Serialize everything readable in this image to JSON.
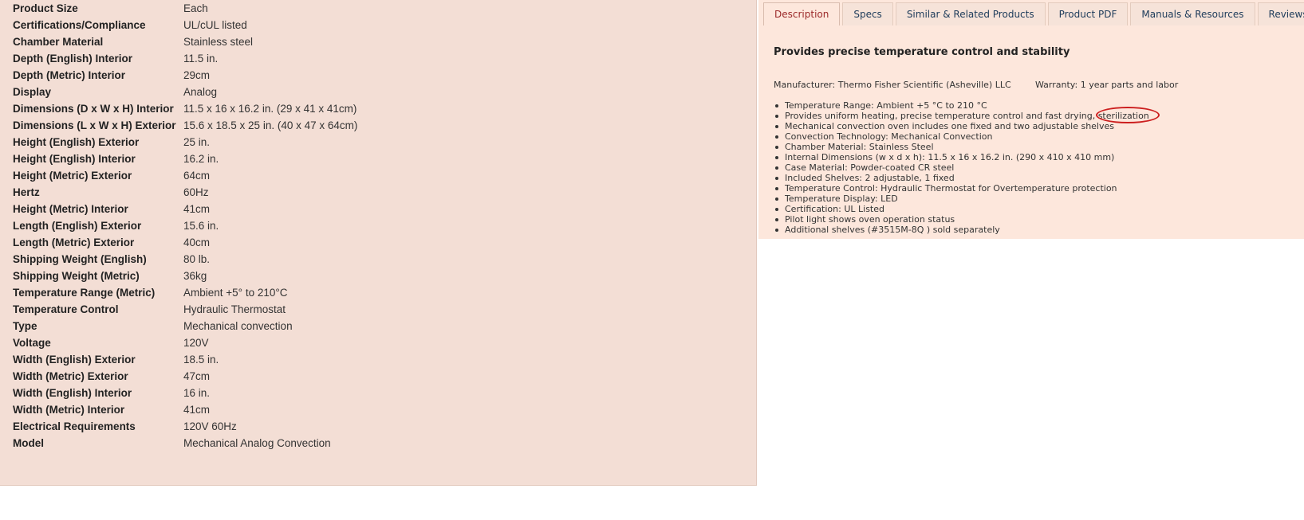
{
  "specs": [
    {
      "name": "Product Size",
      "value": "Each"
    },
    {
      "name": "Certifications/Compliance",
      "value": "UL/cUL listed"
    },
    {
      "name": "Chamber Material",
      "value": "Stainless steel"
    },
    {
      "name": "Depth (English) Interior",
      "value": "11.5 in."
    },
    {
      "name": "Depth (Metric) Interior",
      "value": "29cm"
    },
    {
      "name": "Display",
      "value": "Analog"
    },
    {
      "name": "Dimensions (D x W x H) Interior",
      "value": "11.5 x 16 x 16.2 in. (29 x 41 x 41cm)"
    },
    {
      "name": "Dimensions (L x W x H) Exterior",
      "value": "15.6 x 18.5 x 25 in. (40 x 47 x 64cm)"
    },
    {
      "name": "Height (English) Exterior",
      "value": "25 in."
    },
    {
      "name": "Height (English) Interior",
      "value": "16.2 in."
    },
    {
      "name": "Height (Metric) Exterior",
      "value": "64cm"
    },
    {
      "name": "Hertz",
      "value": "60Hz"
    },
    {
      "name": "Height (Metric) Interior",
      "value": "41cm"
    },
    {
      "name": "Length (English) Exterior",
      "value": "15.6 in."
    },
    {
      "name": "Length (Metric) Exterior",
      "value": "40cm"
    },
    {
      "name": "Shipping Weight (English)",
      "value": "80 lb."
    },
    {
      "name": "Shipping Weight (Metric)",
      "value": "36kg"
    },
    {
      "name": "Temperature Range (Metric)",
      "value": "Ambient +5° to 210°C"
    },
    {
      "name": "Temperature Control",
      "value": "Hydraulic Thermostat"
    },
    {
      "name": "Type",
      "value": "Mechanical convection"
    },
    {
      "name": "Voltage",
      "value": "120V"
    },
    {
      "name": "Width (English) Exterior",
      "value": "18.5 in."
    },
    {
      "name": "Width (Metric) Exterior",
      "value": "47cm"
    },
    {
      "name": "Width (English) Interior",
      "value": "16 in."
    },
    {
      "name": "Width (Metric) Interior",
      "value": "41cm"
    },
    {
      "name": "Electrical Requirements",
      "value": "120V 60Hz"
    },
    {
      "name": "Model",
      "value": "Mechanical Analog Convection"
    }
  ],
  "tabs": [
    {
      "label": "Description",
      "active": true
    },
    {
      "label": "Specs",
      "active": false
    },
    {
      "label": "Similar & Related Products",
      "active": false
    },
    {
      "label": "Product PDF",
      "active": false
    },
    {
      "label": "Manuals & Resources",
      "active": false
    },
    {
      "label": "Reviews",
      "active": false
    }
  ],
  "description": {
    "heading": "Provides precise temperature control and stability",
    "manufacturer": "Manufacturer: Thermo Fisher Scientific (Asheville) LLC",
    "warranty": "Warranty: 1 year parts and labor",
    "features": [
      "Temperature Range: Ambient +5 °C to 210 °C",
      "Provides uniform heating, precise temperature control and fast drying, sterilization",
      "Mechanical convection oven includes one fixed and two adjustable shelves",
      "Convection Technology: Mechanical Convection",
      "Chamber Material: Stainless Steel",
      "Internal Dimensions (w x d x h): 11.5 x 16 x 16.2 in. (290 x 410 x 410 mm)",
      "Case Material: Powder-coated CR steel",
      "Included Shelves: 2 adjustable, 1 fixed",
      "Temperature Control: Hydraulic Thermostat for Overtemperature protection",
      "Temperature Display: LED",
      "Certification: UL Listed",
      "Pilot light shows oven operation status",
      "Additional shelves (#3515M-8Q ) sold separately"
    ]
  },
  "colors": {
    "panel_left": "#f3ded5",
    "panel_right": "#fde7dc",
    "active_tab_text": "#9c2a2a",
    "tab_text": "#1d3b5a",
    "annotation": "#cc1f1f"
  }
}
